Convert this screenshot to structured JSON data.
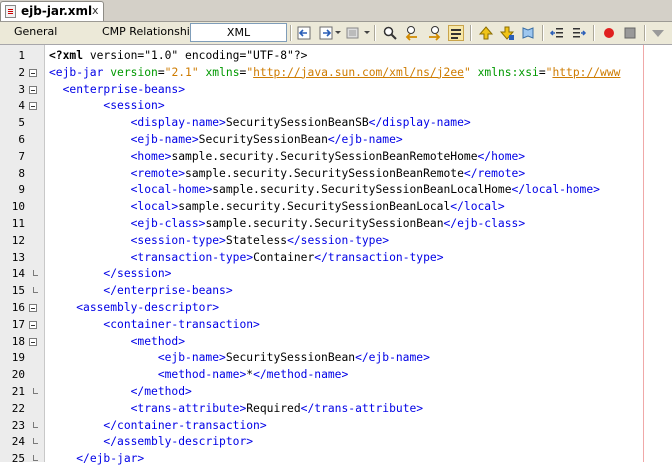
{
  "file_tab": {
    "title": "ejb-jar.xml",
    "close": "x"
  },
  "toolbar": {
    "tabs": [
      "General",
      "CMP Relationships",
      "XML"
    ],
    "icons": [
      "back-icon",
      "forward-icon",
      "history-icon",
      "find-icon",
      "find-previous-icon",
      "find-next-icon",
      "toggle-highlight-icon",
      "previous-bookmark-icon",
      "next-bookmark-icon",
      "toggle-bookmark-icon",
      "shift-left-icon",
      "shift-right-icon",
      "record-macro-icon",
      "stop-macro-icon",
      "validate-icon"
    ]
  },
  "colors": {
    "tag": "#0000e6",
    "attribute": "#009900",
    "value": "#ce7b00",
    "text": "#000000",
    "gutter": "#ececec",
    "margin": "#f0a8a8"
  },
  "editor": {
    "line_numbers": [
      "1",
      "2",
      "3",
      "4",
      "5",
      "6",
      "7",
      "8",
      "9",
      "10",
      "11",
      "12",
      "13",
      "14",
      "15",
      "16",
      "17",
      "18",
      "19",
      "20",
      "21",
      "22",
      "23",
      "24",
      "25"
    ],
    "lines": [
      [
        [
          "pi",
          "<?xml"
        ],
        [
          "p",
          " version=\"1.0\" encoding=\"UTF-8\"?>"
        ]
      ],
      [
        [
          "t",
          "<ejb-jar"
        ],
        [
          "p",
          " "
        ],
        [
          "a",
          "version"
        ],
        [
          "p",
          "="
        ],
        [
          "v",
          "\"2.1\""
        ],
        [
          "p",
          " "
        ],
        [
          "a",
          "xmlns"
        ],
        [
          "p",
          "="
        ],
        [
          "v",
          "\""
        ],
        [
          "u",
          "http://java.sun.com/xml/ns/j2ee"
        ],
        [
          "v",
          "\""
        ],
        [
          "p",
          " "
        ],
        [
          "a",
          "xmlns:xsi"
        ],
        [
          "p",
          "="
        ],
        [
          "v",
          "\""
        ],
        [
          "u",
          "http://www"
        ]
      ],
      [
        [
          "p",
          "  "
        ],
        [
          "t",
          "<enterprise-beans>"
        ]
      ],
      [
        [
          "p",
          "        "
        ],
        [
          "t",
          "<session>"
        ]
      ],
      [
        [
          "p",
          "            "
        ],
        [
          "t",
          "<display-name>"
        ],
        [
          "p",
          "SecuritySessionBeanSB"
        ],
        [
          "t",
          "</display-name>"
        ]
      ],
      [
        [
          "p",
          "            "
        ],
        [
          "t",
          "<ejb-name>"
        ],
        [
          "p",
          "SecuritySessionBean"
        ],
        [
          "t",
          "</ejb-name>"
        ]
      ],
      [
        [
          "p",
          "            "
        ],
        [
          "t",
          "<home>"
        ],
        [
          "p",
          "sample.security.SecuritySessionBeanRemoteHome"
        ],
        [
          "t",
          "</home>"
        ]
      ],
      [
        [
          "p",
          "            "
        ],
        [
          "t",
          "<remote>"
        ],
        [
          "p",
          "sample.security.SecuritySessionBeanRemote"
        ],
        [
          "t",
          "</remote>"
        ]
      ],
      [
        [
          "p",
          "            "
        ],
        [
          "t",
          "<local-home>"
        ],
        [
          "p",
          "sample.security.SecuritySessionBeanLocalHome"
        ],
        [
          "t",
          "</local-home>"
        ]
      ],
      [
        [
          "p",
          "            "
        ],
        [
          "t",
          "<local>"
        ],
        [
          "p",
          "sample.security.SecuritySessionBeanLocal"
        ],
        [
          "t",
          "</local>"
        ]
      ],
      [
        [
          "p",
          "            "
        ],
        [
          "t",
          "<ejb-class>"
        ],
        [
          "p",
          "sample.security.SecuritySessionBean"
        ],
        [
          "t",
          "</ejb-class>"
        ]
      ],
      [
        [
          "p",
          "            "
        ],
        [
          "t",
          "<session-type>"
        ],
        [
          "p",
          "Stateless"
        ],
        [
          "t",
          "</session-type>"
        ]
      ],
      [
        [
          "p",
          "            "
        ],
        [
          "t",
          "<transaction-type>"
        ],
        [
          "p",
          "Container"
        ],
        [
          "t",
          "</transaction-type>"
        ]
      ],
      [
        [
          "p",
          "        "
        ],
        [
          "t",
          "</session>"
        ]
      ],
      [
        [
          "p",
          "        "
        ],
        [
          "t",
          "</enterprise-beans>"
        ]
      ],
      [
        [
          "p",
          "    "
        ],
        [
          "t",
          "<assembly-descriptor>"
        ]
      ],
      [
        [
          "p",
          "        "
        ],
        [
          "t",
          "<container-transaction>"
        ]
      ],
      [
        [
          "p",
          "            "
        ],
        [
          "t",
          "<method>"
        ]
      ],
      [
        [
          "p",
          "                "
        ],
        [
          "t",
          "<ejb-name>"
        ],
        [
          "p",
          "SecuritySessionBean"
        ],
        [
          "t",
          "</ejb-name>"
        ]
      ],
      [
        [
          "p",
          "                "
        ],
        [
          "t",
          "<method-name>"
        ],
        [
          "p",
          "*"
        ],
        [
          "t",
          "</method-name>"
        ]
      ],
      [
        [
          "p",
          "            "
        ],
        [
          "t",
          "</method>"
        ]
      ],
      [
        [
          "p",
          "            "
        ],
        [
          "t",
          "<trans-attribute>"
        ],
        [
          "p",
          "Required"
        ],
        [
          "t",
          "</trans-attribute>"
        ]
      ],
      [
        [
          "p",
          "        "
        ],
        [
          "t",
          "</container-transaction>"
        ]
      ],
      [
        [
          "p",
          "        "
        ],
        [
          "t",
          "</assembly-descriptor>"
        ]
      ],
      [
        [
          "p",
          "    "
        ],
        [
          "t",
          "</ejb-jar>"
        ]
      ]
    ],
    "fold_open": [
      2,
      3,
      4,
      16,
      17,
      18
    ],
    "fold_end": [
      14,
      15,
      21,
      23,
      24,
      25
    ]
  }
}
